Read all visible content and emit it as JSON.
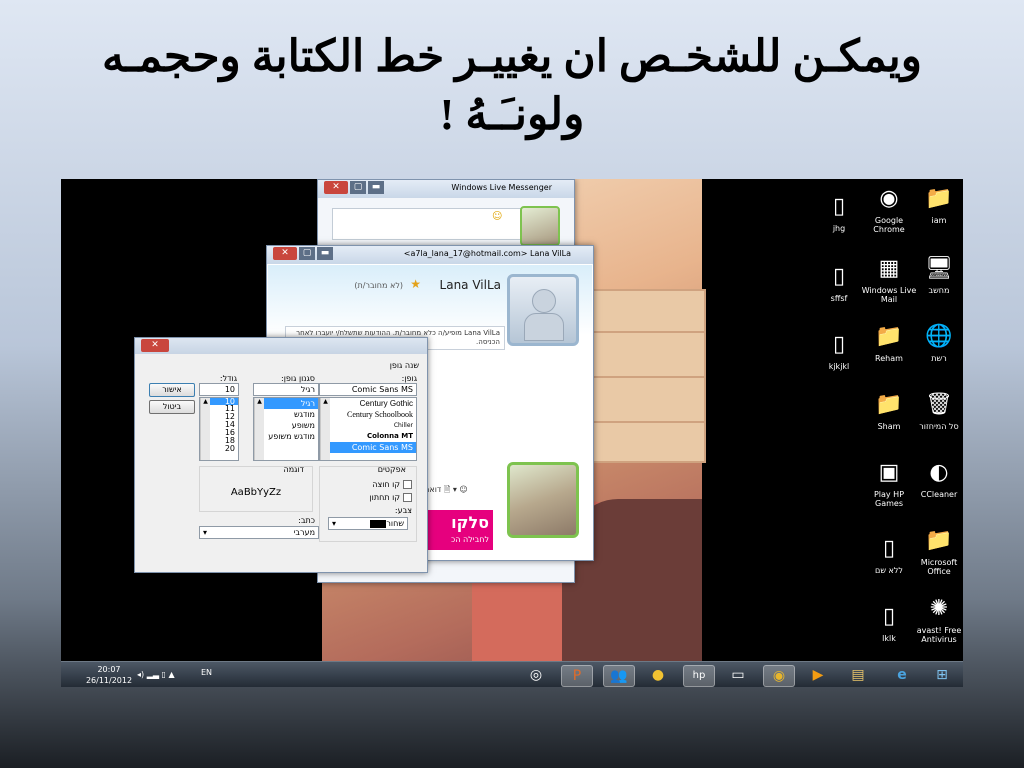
{
  "slide": {
    "title_line1": "ويمكـن للشخـص ان يغييـر خط الكتابة وحجمـه",
    "title_line2": "ولونـَـهُ !"
  },
  "desktop": {
    "icons": [
      {
        "label": "iam",
        "icon": "folder-user-icon",
        "glyph": "📁"
      },
      {
        "label": "Google Chrome",
        "icon": "chrome-icon",
        "glyph": "◉"
      },
      {
        "label": "jhg",
        "icon": "file-shortcut-icon",
        "glyph": "▯"
      },
      {
        "label": "מחשב",
        "icon": "computer-icon",
        "glyph": "🖥"
      },
      {
        "label": "Windows Live Mail",
        "icon": "live-mail-icon",
        "glyph": "▦"
      },
      {
        "label": "sffsf",
        "icon": "file-shortcut-icon",
        "glyph": "▯"
      },
      {
        "label": "רשת",
        "icon": "network-globe-icon",
        "glyph": "🌐"
      },
      {
        "label": "Reham",
        "icon": "folder-icon",
        "glyph": "📁"
      },
      {
        "label": "kjkjkl",
        "icon": "file-shortcut-icon",
        "glyph": "▯"
      },
      {
        "label": "סל המיחזור",
        "icon": "recycle-bin-icon",
        "glyph": "🗑"
      },
      {
        "label": "Sham",
        "icon": "folder-icon",
        "glyph": "📁"
      },
      {
        "label": "CCleaner",
        "icon": "ccleaner-icon",
        "glyph": "◐"
      },
      {
        "label": "Play HP Games",
        "icon": "hp-games-icon",
        "glyph": "▣"
      },
      {
        "label": "Microsoft Office",
        "icon": "folder-office-icon",
        "glyph": "📁"
      },
      {
        "label": "ללא שם",
        "icon": "file-shortcut-icon",
        "glyph": "▯"
      },
      {
        "label": "avast! Free Antivirus",
        "icon": "avast-icon",
        "glyph": "✺"
      },
      {
        "label": "lklk",
        "icon": "file-shortcut-icon",
        "glyph": "▯"
      }
    ]
  },
  "taskbar": {
    "time": "20:07",
    "date": "26/11/2012",
    "lang": "EN",
    "apps": [
      {
        "name": "system-tool-icon",
        "glyph": "◎"
      },
      {
        "name": "powerpoint-icon",
        "glyph": "P",
        "active": true
      },
      {
        "name": "messenger-icon",
        "glyph": "👥",
        "active": true
      },
      {
        "name": "media-player-icon",
        "glyph": "●"
      },
      {
        "name": "hp-icon",
        "glyph": "hp",
        "active": true
      },
      {
        "name": "network-tool-icon",
        "glyph": "▭"
      },
      {
        "name": "chrome-icon",
        "glyph": "◉"
      },
      {
        "name": "player-icon",
        "glyph": "▶"
      },
      {
        "name": "explorer-folder-icon",
        "glyph": "▤"
      },
      {
        "name": "internet-explorer-icon",
        "glyph": "e"
      },
      {
        "name": "start-orb-icon",
        "glyph": "⊞"
      }
    ]
  },
  "messenger_back": {
    "title": "Windows Live Messenger"
  },
  "chat": {
    "title": "<a7la_lana_17@hotmail.com> Lana VilLa",
    "contact_name": "Lana VilLa",
    "contact_status": "(לא מחובר/ת)",
    "notice": "Lana VilLa מופיע/ה כלא מחובר/ת. ההודעות שתשלח/י יועברו לאחר הכניסה.",
    "toolbar_text": "☺ ▾ 🗎 דואר א",
    "ad_text": "סלקו",
    "ad_sub": "לחבילה הכ"
  },
  "font_dialog": {
    "title": "שנה גופן",
    "font_label": "גופן:",
    "style_label": "סגנון גופן:",
    "size_label": "גודל:",
    "font_value": "Comic Sans MS",
    "style_value": "רגיל",
    "size_value": "10",
    "fonts": [
      "Century Gothic",
      "Century Schoolbook",
      "Chiller",
      "Colonna MT",
      "Comic Sans MS"
    ],
    "styles": [
      "רגיל",
      "מודגש",
      "משופע",
      "מודגש משופע"
    ],
    "sizes": [
      "10",
      "11",
      "12",
      "14",
      "16",
      "18",
      "20"
    ],
    "ok": "אישור",
    "cancel": "ביטול",
    "effects_label": "אפקטים",
    "strike": "קו חוצה",
    "underline": "קו תחתון",
    "color_label": "צבע:",
    "color_value": "שחור",
    "sample_label": "דוגמה",
    "sample_text": "AaBbYyZz",
    "script_label": "כתב:",
    "script_value": "מערבי"
  }
}
